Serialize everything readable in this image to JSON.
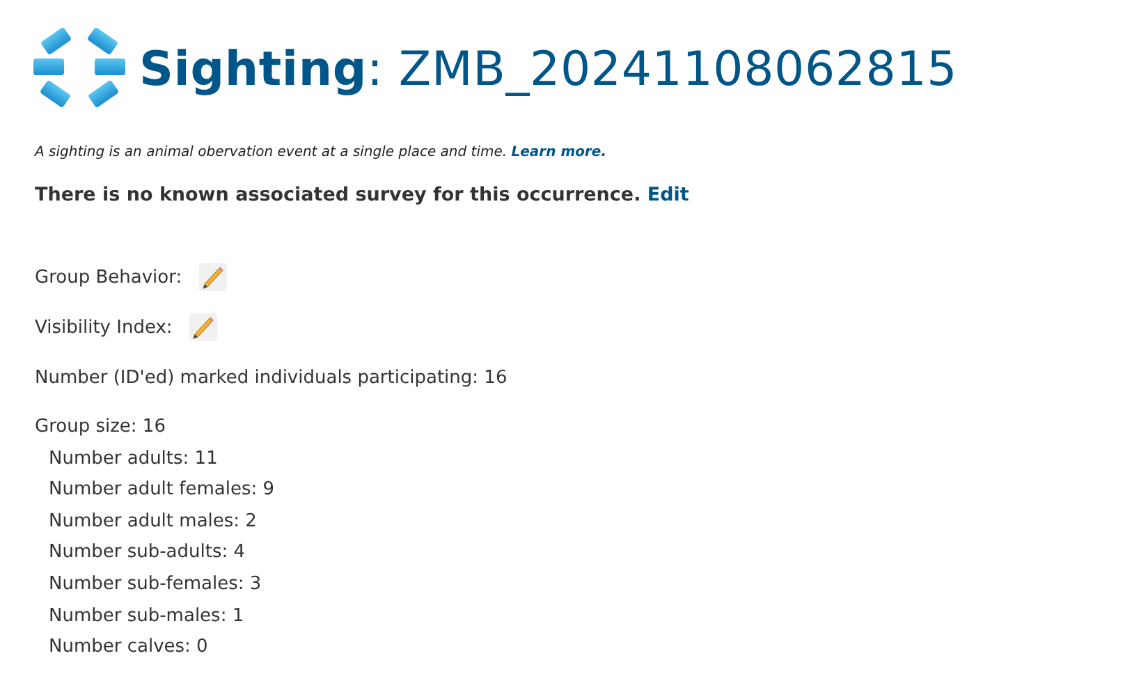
{
  "title": "**Sighting**: ZMB_20241108062815",
  "description": {
    "text": "A sighting is an animal obervation event at a single place and time.",
    "link": "Learn more."
  },
  "survey": {
    "text": "There is no known associated survey for this occurrence.",
    "link": "Edit"
  },
  "fields": [
    {
      "kind": "editable",
      "label": "Group Behavior:"
    },
    {
      "kind": "editable",
      "label": "Visibility Index:"
    },
    {
      "kind": "text",
      "label": "Number (ID'ed) marked individuals participating: 16"
    }
  ],
  "group": {
    "label": "Group size: 16",
    "children": [
      {
        "label": "Number adults: 11"
      },
      {
        "label": "Number adult females: 9"
      },
      {
        "label": "Number adult males: 2"
      },
      {
        "label": "Number sub-adults: 4"
      },
      {
        "label": "Number sub-females: 3"
      },
      {
        "label": "Number sub-males: 1"
      },
      {
        "label": "Number calves: 0"
      }
    ]
  }
}
